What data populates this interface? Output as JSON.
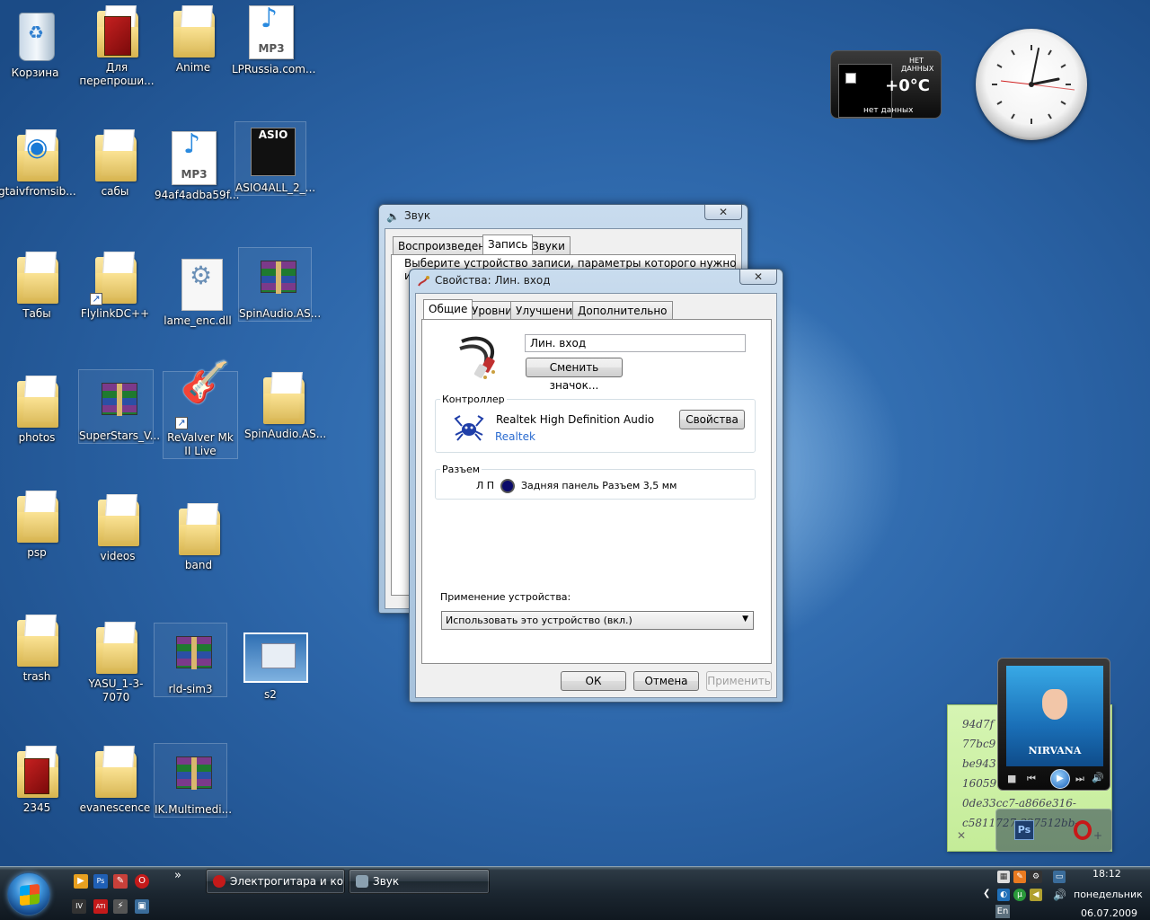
{
  "desktop": {
    "icons": [
      {
        "label": "Корзина"
      },
      {
        "label": "Для перепроши..."
      },
      {
        "label": "Anime"
      },
      {
        "label": "LPRussia.com..."
      },
      {
        "label": "gtaivfromsib..."
      },
      {
        "label": "сабы"
      },
      {
        "label": "94af4adba59f..."
      },
      {
        "label": "ASIO4ALL_2_..."
      },
      {
        "label": "Табы"
      },
      {
        "label": "FlylinkDC++"
      },
      {
        "label": "lame_enc.dll"
      },
      {
        "label": "SpinAudio.AS..."
      },
      {
        "label": "photos"
      },
      {
        "label": "SuperStars_V..."
      },
      {
        "label": "ReValver Mk II Live"
      },
      {
        "label": "SpinAudio.AS..."
      },
      {
        "label": "psp"
      },
      {
        "label": "videos"
      },
      {
        "label": "band"
      },
      {
        "label": "trash"
      },
      {
        "label": "YASU_1-3-7070"
      },
      {
        "label": "rld-sim3"
      },
      {
        "label": "s2"
      },
      {
        "label": "2345"
      },
      {
        "label": "evanescence"
      },
      {
        "label": "IK.Multimedi..."
      }
    ],
    "mp3_badge": "MP3",
    "asio_badge": "ASIO"
  },
  "weather_gadget": {
    "no_data_top": "НЕТ ДАННЫХ",
    "temperature": "+0°C",
    "no_data_bottom": "нет данных"
  },
  "sound_window": {
    "title": "Звук",
    "close": "✕",
    "tabs": [
      "Воспроизведение",
      "Запись",
      "Звуки"
    ],
    "active_tab": 1,
    "instruction": "Выберите устройство записи, параметры которого нужно",
    "instruction_line2": "и"
  },
  "properties_window": {
    "title": "Свойства: Лин. вход",
    "close": "✕",
    "tabs": [
      "Общие",
      "Уровни",
      "Улучшения",
      "Дополнительно"
    ],
    "active_tab": 0,
    "device_name": "Лин. вход",
    "change_icon_button": "Сменить значок...",
    "controller": {
      "group_label": "Контроллер",
      "name": "Realtek High Definition Audio",
      "vendor_link": "Realtek",
      "properties_button": "Свойства"
    },
    "jack": {
      "group_label": "Разъем",
      "channels": "Л П",
      "description": "Задняя панель Разъем 3,5 мм",
      "jack_color": "#0a0a6a"
    },
    "usage": {
      "label": "Применение устройства:",
      "selected": "Использовать это устройство (вкл.)"
    },
    "buttons": {
      "ok": "ОК",
      "cancel": "Отмена",
      "apply": "Применить"
    }
  },
  "sticky_note": {
    "lines": [
      "94d7f",
      "77bc9",
      "be943",
      "16059",
      "0de33cc7-a866e316-",
      "c5811727-327512bb-"
    ],
    "close": "✕",
    "add": "+"
  },
  "media_player": {
    "album_band": "NIRVANA",
    "controls": {
      "stop": "■",
      "prev": "⏮",
      "play": "▶",
      "next": "⏭",
      "volume": "🔊"
    }
  },
  "mini_dock": {
    "ps_label": "Ps"
  },
  "taskbar": {
    "quick_launch": [
      {
        "name": "media-player",
        "text": "▶",
        "color": "#e8a020"
      },
      {
        "name": "photoshop",
        "text": "Ps",
        "color": "#1f5fb5"
      },
      {
        "name": "paint",
        "text": "✎",
        "color": "#c8403a"
      },
      {
        "name": "opera",
        "text": "O",
        "color": "#c41a1a"
      },
      {
        "name": "ivt",
        "text": "IV",
        "color": "#333"
      },
      {
        "name": "ati",
        "text": "ATI",
        "color": "#c41a1a"
      },
      {
        "name": "winamp",
        "text": "⚡",
        "color": "#555"
      },
      {
        "name": "screen",
        "text": "▣",
        "color": "#3a6c9a"
      }
    ],
    "chevron": "»",
    "tasks": [
      {
        "label": "Электрогитара и ко...",
        "icon_color": "#c41a1a"
      },
      {
        "label": "Звук",
        "icon_color": "#8aa0b0"
      }
    ],
    "tray": {
      "expand": "❮",
      "language": "En",
      "time": "18:12",
      "day": "понедельник",
      "date": "06.07.2009"
    }
  }
}
